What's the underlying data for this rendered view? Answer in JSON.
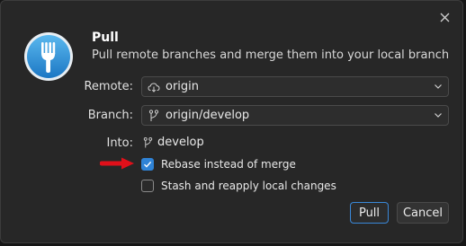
{
  "dialog": {
    "title": "Pull",
    "subtitle": "Pull remote branches and merge them into your local branch",
    "app_icon": "fork-app-icon",
    "close_icon": "close-icon"
  },
  "form": {
    "remote_label": "Remote:",
    "remote_value": "origin",
    "remote_icon": "cloud-icon",
    "branch_label": "Branch:",
    "branch_value": "origin/develop",
    "branch_icon": "branch-icon",
    "into_label": "Into:",
    "into_value": "develop",
    "into_icon": "branch-icon"
  },
  "options": [
    {
      "label": "Rebase instead of merge",
      "checked": true
    },
    {
      "label": "Stash and reapply local changes",
      "checked": false
    }
  ],
  "annotation": {
    "icon": "red-arrow-icon",
    "color": "#e0101a"
  },
  "buttons": {
    "pull_label": "Pull",
    "cancel_label": "Cancel"
  },
  "colors": {
    "accent": "#2f83d6",
    "dialog_bg": "#272727"
  }
}
